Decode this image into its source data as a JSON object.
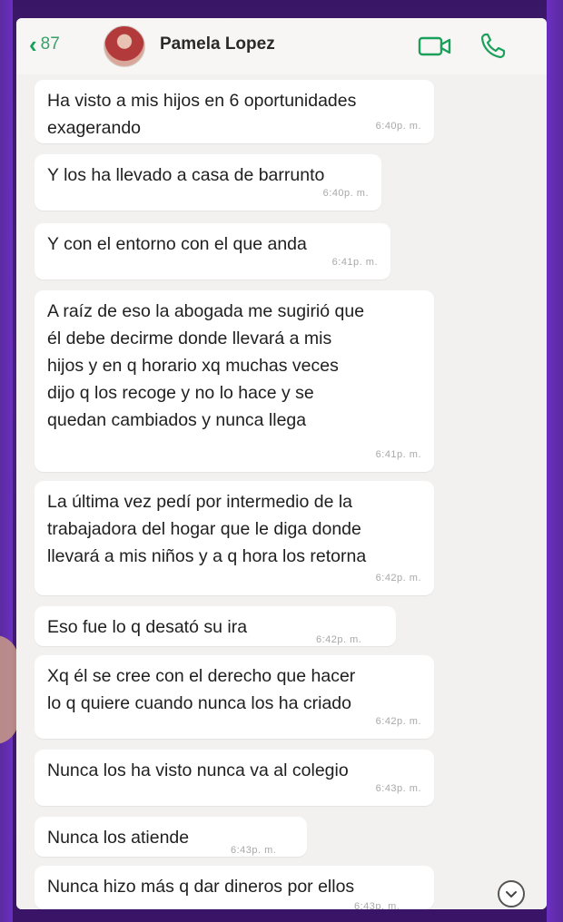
{
  "header": {
    "back_count": "87",
    "contact_name": "Pamela Lopez"
  },
  "colors": {
    "accent": "#1aa05a",
    "background": "#f2f1ef",
    "bubble": "#ffffff",
    "frame": "#4b1d86"
  },
  "icons": {
    "back": "chevron-left-icon",
    "video": "video-camera-icon",
    "call": "phone-icon",
    "scroll": "chevron-down-circle-icon"
  },
  "messages": [
    {
      "text": "Ha visto a mis hijos en 6 oportunidades\nexagerando",
      "time": "6:40p. m."
    },
    {
      "text": "Y los ha llevado a casa de barrunto",
      "time": "6:40p. m."
    },
    {
      "text": "Y con el entorno con el que anda",
      "time": "6:41p. m."
    },
    {
      "text": "A raíz de eso la abogada me sugirió que\nél debe decirme donde llevará a mis\nhijos y en q horario xq muchas veces\ndijo q los recoge y no lo hace y se\nquedan cambiados y nunca llega",
      "time": "6:41p. m."
    },
    {
      "text": "La última vez pedí por intermedio de la\ntrabajadora del hogar que le diga donde\nllevará a mis niños y a q hora los retorna",
      "time": "6:42p. m."
    },
    {
      "text": "Eso fue lo q desató su ira",
      "time": "6:42p. m."
    },
    {
      "text": "Xq él se cree con el derecho que hacer\nlo q quiere cuando nunca los ha criado",
      "time": "6:42p. m."
    },
    {
      "text": "Nunca los ha visto nunca va al colegio",
      "time": "6:43p. m."
    },
    {
      "text": "Nunca los atiende",
      "time": "6:43p. m."
    },
    {
      "text": "Nunca hizo más q dar dineros por ellos",
      "time": "6:43p. m."
    }
  ]
}
